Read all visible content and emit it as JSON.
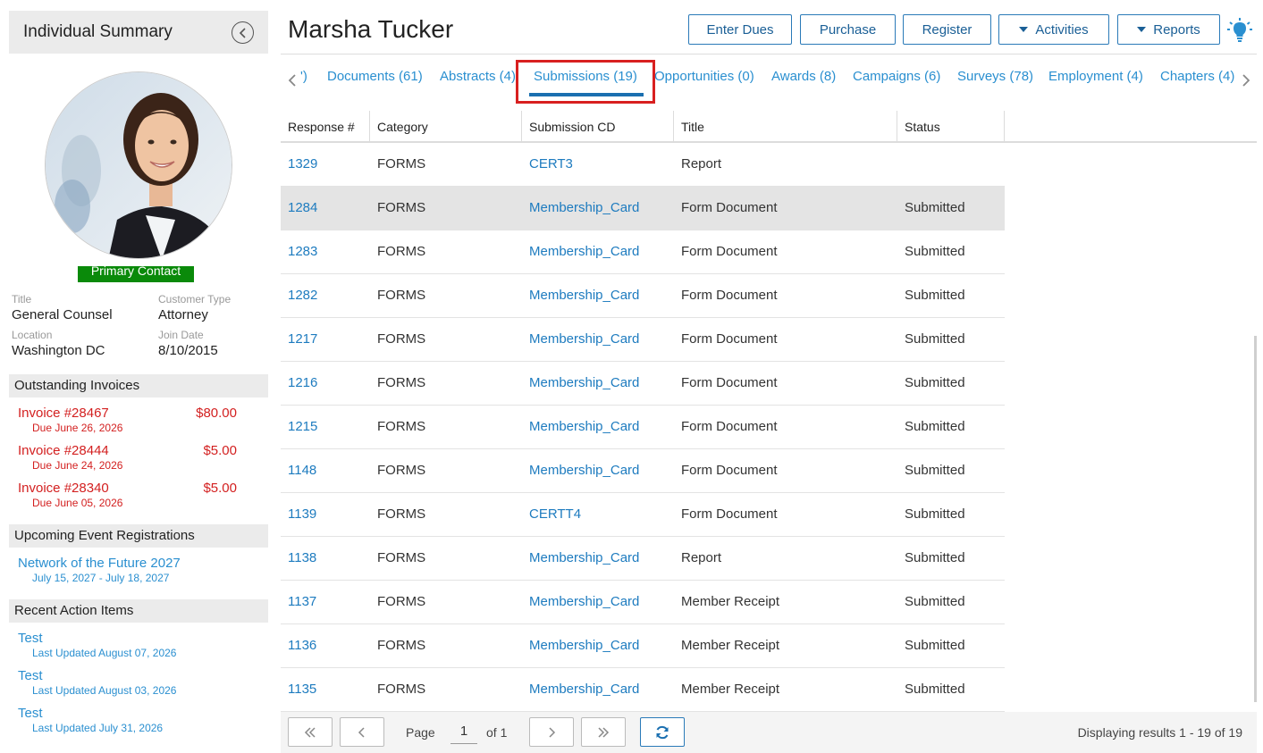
{
  "sidebar": {
    "header": "Individual Summary",
    "badge": "Primary Contact",
    "fields": [
      {
        "label": "Title",
        "value": "General Counsel"
      },
      {
        "label": "Customer Type",
        "value": "Attorney"
      },
      {
        "label": "Location",
        "value": "Washington DC"
      },
      {
        "label": "Join Date",
        "value": "8/10/2015"
      }
    ],
    "invoices_header": "Outstanding Invoices",
    "invoices": [
      {
        "name": "Invoice #28467",
        "amount": "$80.00",
        "due": "Due June 26, 2026"
      },
      {
        "name": "Invoice #28444",
        "amount": "$5.00",
        "due": "Due June 24, 2026"
      },
      {
        "name": "Invoice #28340",
        "amount": "$5.00",
        "due": "Due June 05, 2026"
      }
    ],
    "events_header": "Upcoming Event Registrations",
    "events": [
      {
        "name": "Network of the Future 2027",
        "dates": "July 15, 2027 - July 18, 2027"
      }
    ],
    "actions_header": "Recent Action Items",
    "actions": [
      {
        "name": "Test",
        "updated": "Last Updated August 07, 2026"
      },
      {
        "name": "Test",
        "updated": "Last Updated August 03, 2026"
      },
      {
        "name": "Test",
        "updated": "Last Updated July 31, 2026"
      }
    ]
  },
  "header": {
    "name": "Marsha Tucker",
    "buttons": [
      "Enter Dues",
      "Purchase",
      "Register",
      "Activities",
      "Reports"
    ]
  },
  "tabs": [
    "')",
    "Documents (61)",
    "Abstracts (4)",
    "Submissions (19)",
    "Opportunities (0)",
    "Awards (8)",
    "Campaigns (6)",
    "Surveys (78)",
    "Employment (4)",
    "Chapters (4)"
  ],
  "active_tab": "Submissions (19)",
  "table": {
    "columns": [
      "Response #",
      "Category",
      "Submission CD",
      "Title",
      "Status"
    ],
    "rows": [
      [
        "1329",
        "FORMS",
        "CERT3",
        "Report",
        ""
      ],
      [
        "1284",
        "FORMS",
        "Membership_Card",
        "Form Document",
        "Submitted"
      ],
      [
        "1283",
        "FORMS",
        "Membership_Card",
        "Form Document",
        "Submitted"
      ],
      [
        "1282",
        "FORMS",
        "Membership_Card",
        "Form Document",
        "Submitted"
      ],
      [
        "1217",
        "FORMS",
        "Membership_Card",
        "Form Document",
        "Submitted"
      ],
      [
        "1216",
        "FORMS",
        "Membership_Card",
        "Form Document",
        "Submitted"
      ],
      [
        "1215",
        "FORMS",
        "Membership_Card",
        "Form Document",
        "Submitted"
      ],
      [
        "1148",
        "FORMS",
        "Membership_Card",
        "Form Document",
        "Submitted"
      ],
      [
        "1139",
        "FORMS",
        "CERTT4",
        "Form Document",
        "Submitted"
      ],
      [
        "1138",
        "FORMS",
        "Membership_Card",
        "Report",
        "Submitted"
      ],
      [
        "1137",
        "FORMS",
        "Membership_Card",
        "Member Receipt",
        "Submitted"
      ],
      [
        "1136",
        "FORMS",
        "Membership_Card",
        "Member Receipt",
        "Submitted"
      ],
      [
        "1135",
        "FORMS",
        "Membership_Card",
        "Member Receipt",
        "Submitted"
      ]
    ],
    "selected_row": 1
  },
  "pager": {
    "page_label": "Page",
    "page_value": "1",
    "of_label": "of 1",
    "info": "Displaying results 1 - 19 of 19"
  },
  "colors": {
    "link": "#2a8fd0",
    "invoice": "#d32020",
    "badge": "#0a8a0a",
    "highlight": "#d82020"
  }
}
